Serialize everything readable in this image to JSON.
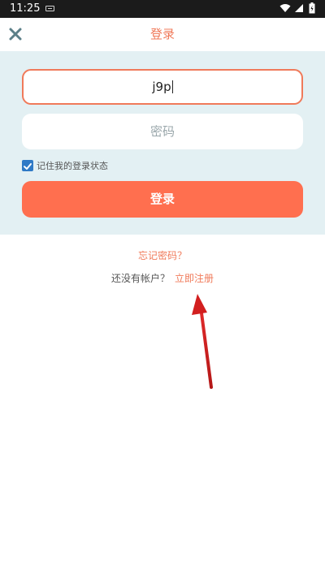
{
  "status_bar": {
    "time": "11:25",
    "icons": [
      "keyboard-icon",
      "wifi-icon",
      "signal-icon",
      "battery-icon"
    ]
  },
  "header": {
    "title": "登录",
    "close_icon": "close-icon"
  },
  "form": {
    "username_value": "j9p",
    "password_placeholder": "密码",
    "remember_checked": true,
    "remember_label": "记住我的登录状态",
    "login_button": "登录"
  },
  "links": {
    "forgot_password": "忘记密码？",
    "no_account_prompt": "还没有帐户？",
    "register_now": "立即注册"
  },
  "colors": {
    "accent": "#f07a5a",
    "button": "#ff6f4f",
    "panel_bg": "#e3f0f3",
    "checkbox": "#2f7ac6",
    "annotation_arrow": "#d21f1f"
  }
}
